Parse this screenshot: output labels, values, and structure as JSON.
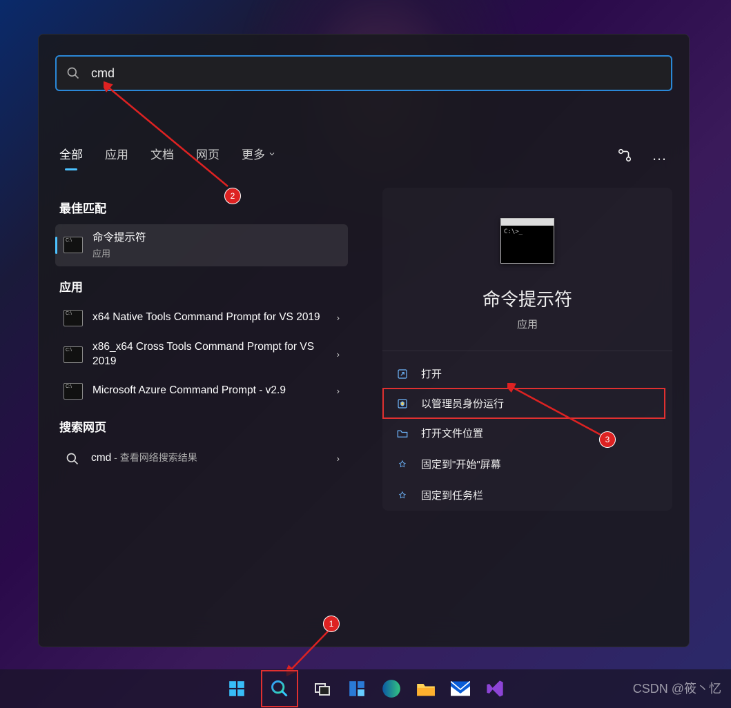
{
  "search": {
    "query": "cmd"
  },
  "tabs": {
    "all": "全部",
    "apps": "应用",
    "docs": "文档",
    "web": "网页",
    "more": "更多"
  },
  "sections": {
    "best_match": "最佳匹配",
    "apps": "应用",
    "search_web": "搜索网页"
  },
  "best_match": {
    "title": "命令提示符",
    "subtitle": "应用"
  },
  "app_results": [
    {
      "title": "x64 Native Tools Command Prompt for VS 2019"
    },
    {
      "title": "x86_x64 Cross Tools Command Prompt for VS 2019"
    },
    {
      "title": "Microsoft Azure Command Prompt - v2.9"
    }
  ],
  "web_result": {
    "term": "cmd",
    "suffix": " - 查看网络搜索结果"
  },
  "preview": {
    "title": "命令提示符",
    "subtitle": "应用",
    "actions": {
      "open": "打开",
      "run_admin": "以管理员身份运行",
      "open_location": "打开文件位置",
      "pin_start": "固定到\"开始\"屏幕",
      "pin_taskbar": "固定到任务栏"
    }
  },
  "annotations": {
    "n1": "1",
    "n2": "2",
    "n3": "3"
  },
  "watermark": "CSDN @筱丶忆"
}
